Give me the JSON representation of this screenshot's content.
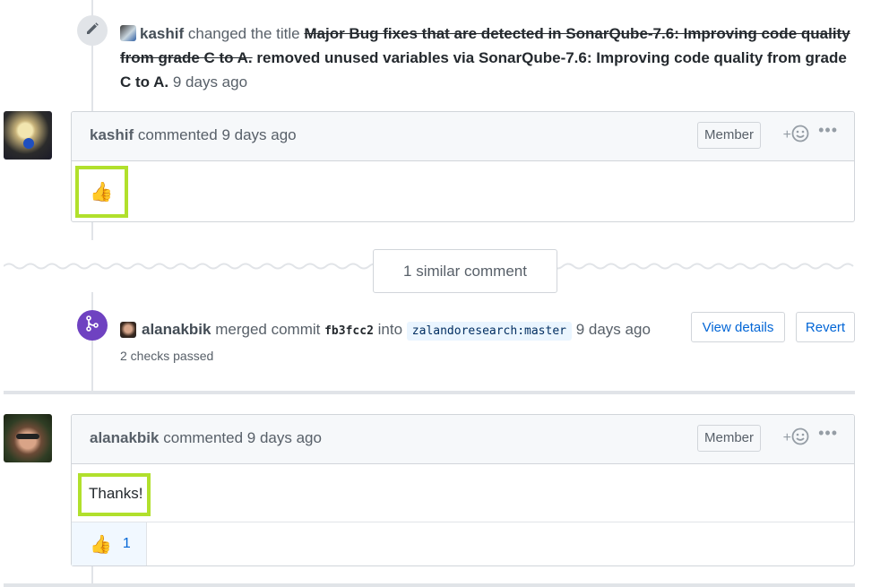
{
  "rename_event": {
    "actor": "kashif",
    "action": "changed the title",
    "old_title": "Major Bug fixes that are detected in SonarQube-7.6: Improving code quality from grade C to A.",
    "new_title": "removed unused variables via SonarQube-7.6: Improving code quality from grade C to A.",
    "time": "9 days ago",
    "icon": "pencil-icon"
  },
  "comment1": {
    "author": "kashif",
    "action": "commented",
    "time": "9 days ago",
    "badge": "Member",
    "body_emoji": "👍",
    "react_label": "+",
    "more_label": "•••"
  },
  "hidden_items": {
    "label": "1 similar comment"
  },
  "merge_event": {
    "actor": "alanakbik",
    "action": "merged commit",
    "commit": "fb3fcc2",
    "into": "into",
    "branch": "zalandoresearch:master",
    "time": "9 days ago",
    "checks": "2 checks passed",
    "view_details": "View details",
    "revert": "Revert",
    "badge_color": "#6f42c1",
    "icon": "merge-icon"
  },
  "comment2": {
    "author": "alanakbik",
    "action": "commented",
    "time": "9 days ago",
    "badge": "Member",
    "body": "Thanks!",
    "reaction_emoji": "👍",
    "reaction_count": "1",
    "react_label": "+",
    "more_label": "•••"
  },
  "colors": {
    "highlight": "#b1e02c",
    "link": "#0366d6"
  }
}
